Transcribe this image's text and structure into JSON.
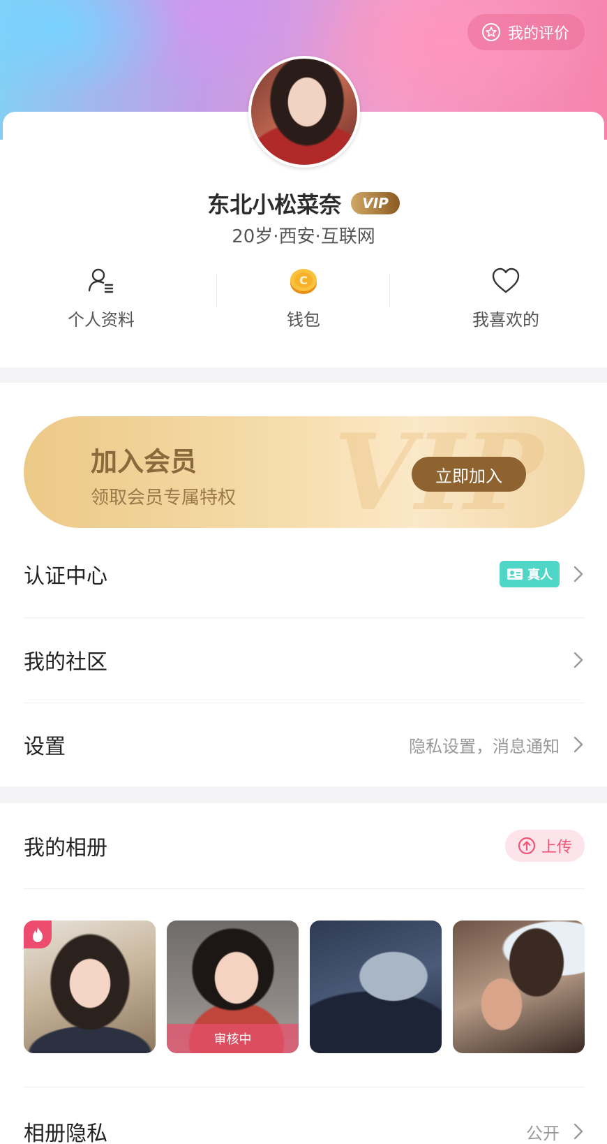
{
  "header": {
    "rate_label": "我的评价"
  },
  "profile": {
    "name": "东北小松菜奈",
    "vip_label": "VIP",
    "info": "20岁·西安·互联网"
  },
  "quick_actions": [
    {
      "label": "个人资料",
      "icon": "profile-icon"
    },
    {
      "label": "钱包",
      "icon": "coin-icon"
    },
    {
      "label": "我喜欢的",
      "icon": "heart-icon"
    }
  ],
  "vip_banner": {
    "title": "加入会员",
    "subtitle": "领取会员专属特权",
    "button": "立即加入",
    "watermark": "VIP"
  },
  "menu": {
    "auth": {
      "title": "认证中心",
      "badge": "真人"
    },
    "community": {
      "title": "我的社区"
    },
    "settings": {
      "title": "设置",
      "hint": "隐私设置，消息通知"
    }
  },
  "album": {
    "title": "我的相册",
    "upload": "上传",
    "review_label": "审核中",
    "privacy_title": "相册隐私",
    "privacy_value": "公开"
  },
  "colors": {
    "accent_pink": "#ee4c6e",
    "vip_brown": "#8e6330",
    "real_badge": "#4fd6c7"
  }
}
